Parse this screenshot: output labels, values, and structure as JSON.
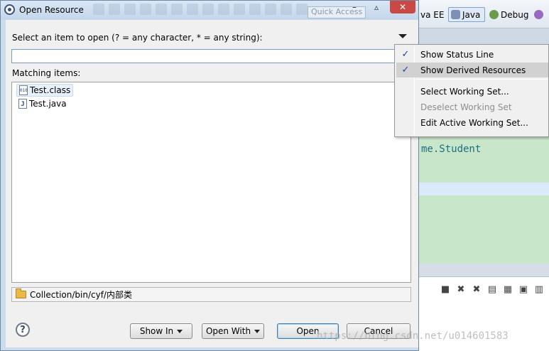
{
  "dialog": {
    "title": "Open Resource",
    "prompt": "Select an item to open (? = any character, * = any string):",
    "search_value": "",
    "matching_label": "Matching items:",
    "items": [
      {
        "label": "Test.class",
        "icon": "class-file-icon"
      },
      {
        "label": "Test.java",
        "icon": "java-file-icon"
      }
    ],
    "status_path": "Collection/bin/cyf/内部类",
    "buttons": {
      "show_in": "Show In",
      "open_with": "Open With",
      "open": "Open",
      "cancel": "Cancel"
    }
  },
  "menu": {
    "items": [
      {
        "label": "Show Status Line",
        "checked": true
      },
      {
        "label": "Show Derived Resources",
        "checked": true
      },
      {
        "label": "Select Working Set..."
      },
      {
        "label": "Deselect Working Set",
        "disabled": true
      },
      {
        "label": "Edit Active Working Set..."
      }
    ]
  },
  "background": {
    "perspectives": [
      "va EE",
      "Java",
      "Debug"
    ],
    "code_text": "me.Student",
    "quick_access": "Quick Access"
  },
  "watermark": "https://blog.csdn.net/u014601583",
  "colors": {
    "editor_bg": "#c8e6c9",
    "dialog_bg": "#f0f0f0",
    "accent": "#3c7fb1",
    "close_button": "#c94a45"
  }
}
